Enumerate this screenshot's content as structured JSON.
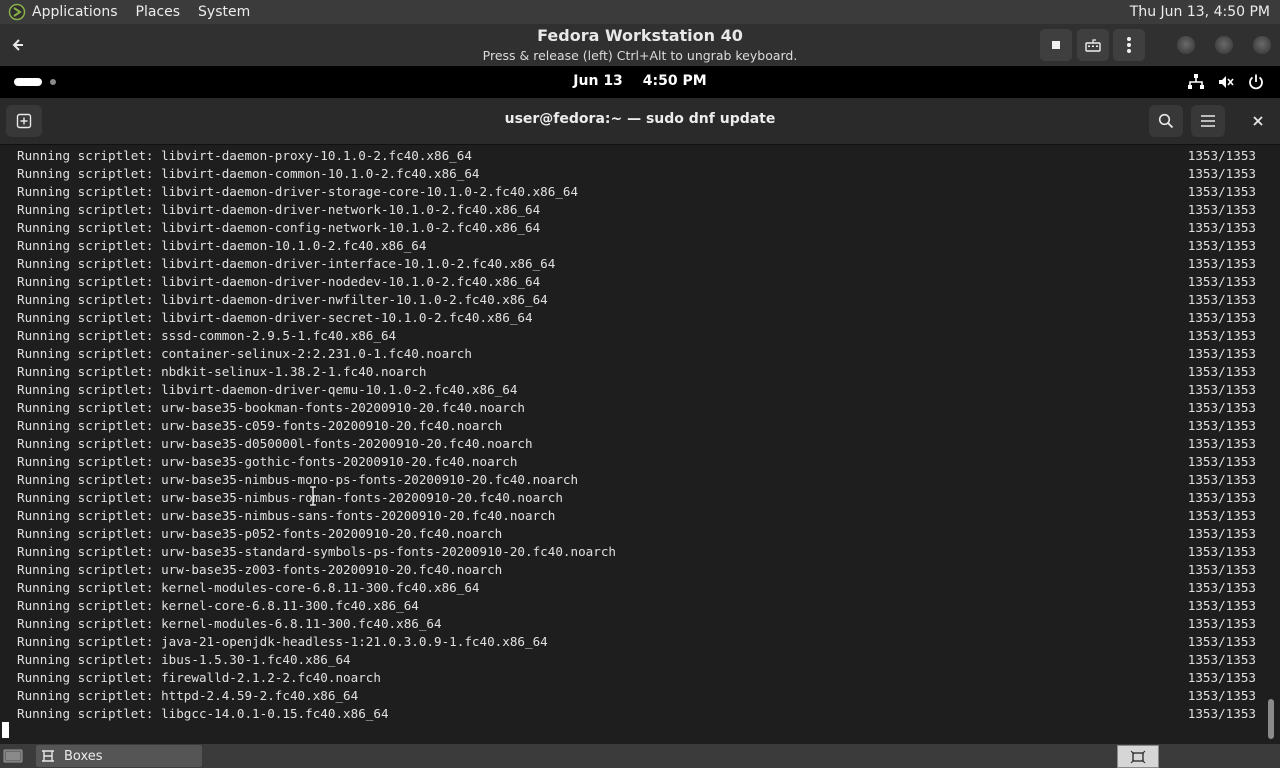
{
  "host_panel": {
    "menus": [
      "Applications",
      "Places",
      "System"
    ],
    "clock": "Thu Jun 13,  4:50 PM"
  },
  "boxes": {
    "title": "Fedora Workstation 40",
    "subtitle": "Press & release (left) Ctrl+Alt to ungrab keyboard."
  },
  "guest_topbar": {
    "date": "Jun 13",
    "time": "4:50 PM"
  },
  "terminal": {
    "title": "user@fedora:~ — sudo dnf update",
    "line_prefix": "Running scriptlet: ",
    "lines": [
      {
        "pkg": "libvirt-daemon-proxy-10.1.0-2.fc40.x86_64",
        "count": "1353/1353"
      },
      {
        "pkg": "libvirt-daemon-common-10.1.0-2.fc40.x86_64",
        "count": "1353/1353"
      },
      {
        "pkg": "libvirt-daemon-driver-storage-core-10.1.0-2.fc40.x86_64",
        "count": "1353/1353"
      },
      {
        "pkg": "libvirt-daemon-driver-network-10.1.0-2.fc40.x86_64",
        "count": "1353/1353"
      },
      {
        "pkg": "libvirt-daemon-config-network-10.1.0-2.fc40.x86_64",
        "count": "1353/1353"
      },
      {
        "pkg": "libvirt-daemon-10.1.0-2.fc40.x86_64",
        "count": "1353/1353"
      },
      {
        "pkg": "libvirt-daemon-driver-interface-10.1.0-2.fc40.x86_64",
        "count": "1353/1353"
      },
      {
        "pkg": "libvirt-daemon-driver-nodedev-10.1.0-2.fc40.x86_64",
        "count": "1353/1353"
      },
      {
        "pkg": "libvirt-daemon-driver-nwfilter-10.1.0-2.fc40.x86_64",
        "count": "1353/1353"
      },
      {
        "pkg": "libvirt-daemon-driver-secret-10.1.0-2.fc40.x86_64",
        "count": "1353/1353"
      },
      {
        "pkg": "sssd-common-2.9.5-1.fc40.x86_64",
        "count": "1353/1353"
      },
      {
        "pkg": "container-selinux-2:2.231.0-1.fc40.noarch",
        "count": "1353/1353"
      },
      {
        "pkg": "nbdkit-selinux-1.38.2-1.fc40.noarch",
        "count": "1353/1353"
      },
      {
        "pkg": "libvirt-daemon-driver-qemu-10.1.0-2.fc40.x86_64",
        "count": "1353/1353"
      },
      {
        "pkg": "urw-base35-bookman-fonts-20200910-20.fc40.noarch",
        "count": "1353/1353"
      },
      {
        "pkg": "urw-base35-c059-fonts-20200910-20.fc40.noarch",
        "count": "1353/1353"
      },
      {
        "pkg": "urw-base35-d050000l-fonts-20200910-20.fc40.noarch",
        "count": "1353/1353"
      },
      {
        "pkg": "urw-base35-gothic-fonts-20200910-20.fc40.noarch",
        "count": "1353/1353"
      },
      {
        "pkg": "urw-base35-nimbus-mono-ps-fonts-20200910-20.fc40.noarch",
        "count": "1353/1353"
      },
      {
        "pkg": "urw-base35-nimbus-roman-fonts-20200910-20.fc40.noarch",
        "count": "1353/1353"
      },
      {
        "pkg": "urw-base35-nimbus-sans-fonts-20200910-20.fc40.noarch",
        "count": "1353/1353"
      },
      {
        "pkg": "urw-base35-p052-fonts-20200910-20.fc40.noarch",
        "count": "1353/1353"
      },
      {
        "pkg": "urw-base35-standard-symbols-ps-fonts-20200910-20.fc40.noarch",
        "count": "1353/1353"
      },
      {
        "pkg": "urw-base35-z003-fonts-20200910-20.fc40.noarch",
        "count": "1353/1353"
      },
      {
        "pkg": "kernel-modules-core-6.8.11-300.fc40.x86_64",
        "count": "1353/1353"
      },
      {
        "pkg": "kernel-core-6.8.11-300.fc40.x86_64",
        "count": "1353/1353"
      },
      {
        "pkg": "kernel-modules-6.8.11-300.fc40.x86_64",
        "count": "1353/1353"
      },
      {
        "pkg": "java-21-openjdk-headless-1:21.0.3.0.9-1.fc40.x86_64",
        "count": "1353/1353"
      },
      {
        "pkg": "ibus-1.5.30-1.fc40.x86_64",
        "count": "1353/1353"
      },
      {
        "pkg": "firewalld-2.1.2-2.fc40.noarch",
        "count": "1353/1353"
      },
      {
        "pkg": "httpd-2.4.59-2.fc40.x86_64",
        "count": "1353/1353"
      },
      {
        "pkg": "libgcc-14.0.1-0.15.fc40.x86_64",
        "count": "1353/1353"
      }
    ]
  },
  "taskbar": {
    "task_label": "Boxes"
  },
  "icons": {
    "host_logo": "mate-logo-icon",
    "back": "arrow-left-icon",
    "stop": "stop-icon",
    "keyboard": "keyboard-icon",
    "menu": "vertical-dots-icon",
    "network": "network-wired-icon",
    "volume": "volume-muted-icon",
    "power": "power-icon",
    "new_tab": "new-tab-icon",
    "search": "search-icon",
    "hamburger": "hamburger-menu-icon",
    "close": "close-icon",
    "show_desktop": "show-desktop-icon",
    "workspace": "workspace-icon"
  },
  "colors": {
    "host_panel": "#3b3b3b",
    "guest_topbar": "#000000",
    "terminal_bg": "#1e1e1e",
    "terminal_fg": "#e0e0e0"
  }
}
